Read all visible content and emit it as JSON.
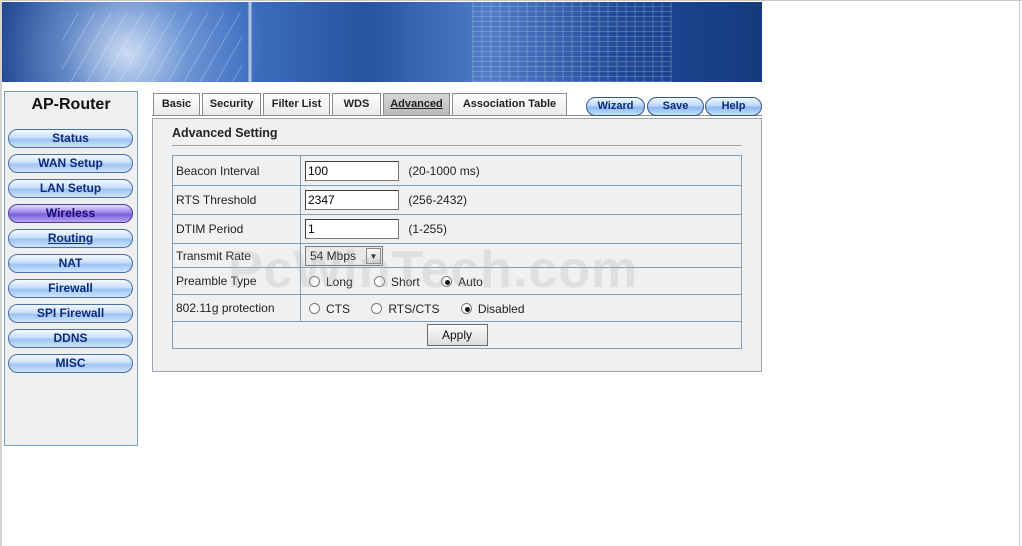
{
  "brand": {
    "title": "AP-Router"
  },
  "sidebar": {
    "items": [
      {
        "label": "Status"
      },
      {
        "label": "WAN Setup"
      },
      {
        "label": "LAN Setup"
      },
      {
        "label": "Wireless"
      },
      {
        "label": "Routing"
      },
      {
        "label": "NAT"
      },
      {
        "label": "Firewall"
      },
      {
        "label": "SPI Firewall"
      },
      {
        "label": "DDNS"
      },
      {
        "label": "MISC"
      }
    ],
    "active_item": "Wireless"
  },
  "tabs": [
    {
      "label": "Basic"
    },
    {
      "label": "Security"
    },
    {
      "label": "Filter List"
    },
    {
      "label": "WDS"
    },
    {
      "label": "Advanced"
    },
    {
      "label": "Association Table"
    }
  ],
  "active_tab": "Advanced",
  "actions": {
    "wizard": "Wizard",
    "save": "Save",
    "help": "Help"
  },
  "section": {
    "title": "Advanced Setting"
  },
  "fields": {
    "beacon": {
      "label": "Beacon Interval",
      "value": "100",
      "range": "(20-1000 ms)"
    },
    "rts": {
      "label": "RTS Threshold",
      "value": "2347",
      "range": "(256-2432)"
    },
    "dtim": {
      "label": "DTIM Period",
      "value": "1",
      "range": "(1-255)"
    },
    "rate": {
      "label": "Transmit Rate",
      "value": "54 Mbps"
    },
    "preamble": {
      "label": "Preamble Type",
      "options": [
        "Long",
        "Short",
        "Auto"
      ],
      "selected": "Auto"
    },
    "protection": {
      "label": "802.11g protection",
      "options": [
        "CTS",
        "RTS/CTS",
        "Disabled"
      ],
      "selected": "Disabled"
    }
  },
  "apply_label": "Apply",
  "watermark": "PcWinTech.com",
  "colors": {
    "accent_blue": "#0d2c7a",
    "active_purple": "#7a5fd8",
    "border": "#7f9fb8"
  }
}
